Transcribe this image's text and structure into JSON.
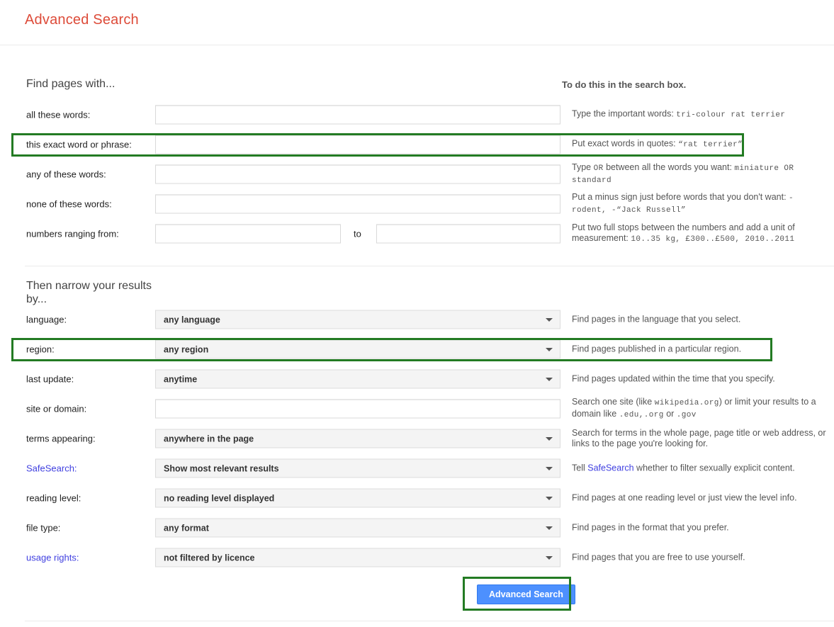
{
  "page": {
    "title": "Advanced Search"
  },
  "section_find": {
    "heading": "Find pages with...",
    "help_heading": "To do this in the search box.",
    "rows": [
      {
        "label": "all these words:",
        "value": "",
        "help_prefix": "Type the important words: ",
        "help_code": "tri-colour rat terrier",
        "help_suffix": ""
      },
      {
        "label": "this exact word or phrase:",
        "value": "",
        "help_prefix": "Put exact words in quotes: ",
        "help_code": "“rat terrier”",
        "help_suffix": ""
      },
      {
        "label": "any of these words:",
        "value": "",
        "help_prefix": "Type ",
        "help_code": "OR",
        "help_suffix": " between all the words you want: ",
        "help_code2": "miniature OR standard"
      },
      {
        "label": "none of these words:",
        "value": "",
        "help_prefix": "Put a minus sign just before words that you don't want: ",
        "help_code": "-rodent, -“Jack Russell”",
        "help_suffix": ""
      },
      {
        "label": "numbers ranging from:",
        "value_from": "",
        "value_to": "",
        "separator": "to",
        "help_prefix": "Put two full stops between the numbers and add a unit of measurement: ",
        "help_code": "10..35 kg, £300..£500, 2010..2011",
        "help_suffix": ""
      }
    ]
  },
  "section_narrow": {
    "heading": "Then narrow your results by...",
    "rows": [
      {
        "label": "language:",
        "label_is_link": false,
        "value": "any language",
        "help": "Find pages in the language that you select."
      },
      {
        "label": "region:",
        "label_is_link": false,
        "value": "any region",
        "help": "Find pages published in a particular region."
      },
      {
        "label": "last update:",
        "label_is_link": false,
        "value": "anytime",
        "help": "Find pages updated within the time that you specify."
      },
      {
        "label": "site or domain:",
        "label_is_link": false,
        "value": "",
        "help_prefix": "Search one site (like ",
        "help_code": "wikipedia.org",
        "help_mid": ") or limit your results to a domain like ",
        "help_code2": ".edu,",
        "help_code3": ".org",
        "help_mid2": " or ",
        "help_code4": ".gov"
      },
      {
        "label": "terms appearing:",
        "label_is_link": false,
        "value": "anywhere in the page",
        "help": "Search for terms in the whole page, page title or web address, or links to the page you're looking for."
      },
      {
        "label": "SafeSearch:",
        "label_is_link": true,
        "value": "Show most relevant results",
        "help_prefix": "Tell ",
        "help_link": "SafeSearch",
        "help_suffix": " whether to filter sexually explicit content."
      },
      {
        "label": "reading level:",
        "label_is_link": false,
        "value": "no reading level displayed",
        "help": "Find pages at one reading level or just view the level info."
      },
      {
        "label": "file type:",
        "label_is_link": false,
        "value": "any format",
        "help": "Find pages in the format that you prefer."
      },
      {
        "label": "usage rights:",
        "label_is_link": true,
        "value": "not filtered by licence",
        "help": "Find pages that you are free to use yourself."
      }
    ]
  },
  "submit": {
    "label": "Advanced Search"
  },
  "colors": {
    "title": "#dd4b39",
    "highlight": "#237b23",
    "button": "#4d90fe",
    "link": "#4040e0"
  }
}
